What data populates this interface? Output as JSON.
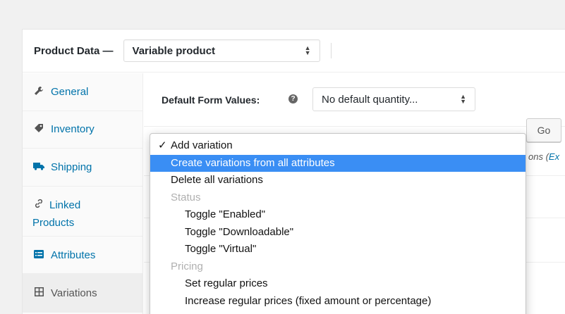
{
  "header": {
    "title": "Product Data —",
    "product_type": "Variable product"
  },
  "sidebar": {
    "items": [
      {
        "label": "General",
        "icon": "wrench-icon"
      },
      {
        "label": "Inventory",
        "icon": "tag-icon"
      },
      {
        "label": "Shipping",
        "icon": "truck-icon"
      },
      {
        "label_line1": "Linked",
        "label_line2": "Products",
        "icon": "link-icon"
      },
      {
        "label": "Attributes",
        "icon": "list-icon"
      },
      {
        "label": "Variations",
        "icon": "grid-icon"
      }
    ]
  },
  "main": {
    "default_form_values_label": "Default Form Values:",
    "default_quantity_value": "No default quantity...",
    "go_label": "Go",
    "peek_text": "ons (",
    "peek_link": "Ex"
  },
  "dropdown": {
    "options": [
      {
        "label": "Add variation",
        "kind": "checked"
      },
      {
        "label": "Create variations from all attributes",
        "kind": "highlight"
      },
      {
        "label": "Delete all variations",
        "kind": "normal"
      },
      {
        "label": "Status",
        "kind": "group"
      },
      {
        "label": "Toggle \"Enabled\"",
        "kind": "sub"
      },
      {
        "label": "Toggle \"Downloadable\"",
        "kind": "sub"
      },
      {
        "label": "Toggle \"Virtual\"",
        "kind": "sub"
      },
      {
        "label": "Pricing",
        "kind": "group"
      },
      {
        "label": "Set regular prices",
        "kind": "sub"
      },
      {
        "label": "Increase regular prices (fixed amount or percentage)",
        "kind": "sub"
      }
    ],
    "checkmark": "✓"
  },
  "colors": {
    "link": "#0073aa",
    "highlight": "#3a8ef4",
    "group_text": "#b0b0b0"
  }
}
